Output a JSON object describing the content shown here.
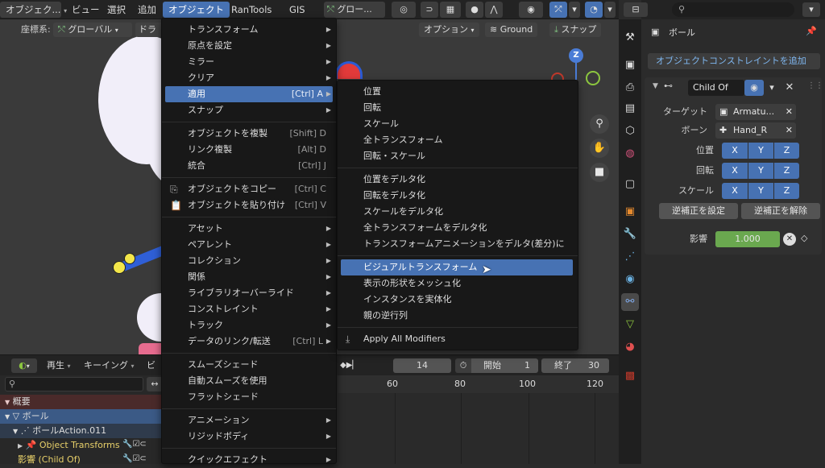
{
  "header": {
    "mode_partial": "オブジェク...",
    "menus": [
      "ビュー",
      "選択",
      "追加",
      "オブジェクト",
      "RanTools",
      "GIS"
    ],
    "active_menu": "オブジェクト",
    "orientation_partial": "グロー..."
  },
  "viewport_header": {
    "coord_label": "座標系:",
    "coord_value": "グローバル",
    "drag_partial": "ドラ",
    "options": "オプション",
    "ground": "Ground",
    "snap": "スナップ"
  },
  "gizmo": {
    "z": "Z"
  },
  "object_menu": {
    "items": [
      {
        "label": "トランスフォーム",
        "shortcut": "",
        "submenu": true
      },
      {
        "label": "原点を設定",
        "shortcut": "",
        "submenu": true
      },
      {
        "label": "ミラー",
        "shortcut": "",
        "submenu": true
      },
      {
        "label": "クリア",
        "shortcut": "",
        "submenu": true
      },
      {
        "label": "適用",
        "shortcut": "[Ctrl] A",
        "submenu": true,
        "highlight": true
      },
      {
        "label": "スナップ",
        "shortcut": "",
        "submenu": true
      },
      {
        "label": "オブジェクトを複製",
        "shortcut": "[Shift] D",
        "submenu": false
      },
      {
        "label": "リンク複製",
        "shortcut": "[Alt] D",
        "submenu": false
      },
      {
        "label": "統合",
        "shortcut": "[Ctrl] J",
        "submenu": false
      },
      {
        "label": "オブジェクトをコピー",
        "shortcut": "[Ctrl] C",
        "submenu": false
      },
      {
        "label": "オブジェクトを貼り付け",
        "shortcut": "[Ctrl] V",
        "submenu": false
      },
      {
        "label": "アセット",
        "shortcut": "",
        "submenu": true
      },
      {
        "label": "ペアレント",
        "shortcut": "",
        "submenu": true
      },
      {
        "label": "コレクション",
        "shortcut": "",
        "submenu": true
      },
      {
        "label": "関係",
        "shortcut": "",
        "submenu": true
      },
      {
        "label": "ライブラリオーバーライド",
        "shortcut": "",
        "submenu": true
      },
      {
        "label": "コンストレイント",
        "shortcut": "",
        "submenu": true
      },
      {
        "label": "トラック",
        "shortcut": "",
        "submenu": true
      },
      {
        "label": "データのリンク/転送",
        "shortcut": "[Ctrl] L",
        "submenu": true
      },
      {
        "label": "スムーズシェード",
        "shortcut": "",
        "submenu": false
      },
      {
        "label": "自動スムーズを使用",
        "shortcut": "",
        "submenu": false
      },
      {
        "label": "フラットシェード",
        "shortcut": "",
        "submenu": false
      },
      {
        "label": "アニメーション",
        "shortcut": "",
        "submenu": true
      },
      {
        "label": "リジッドボディ",
        "shortcut": "",
        "submenu": true
      },
      {
        "label": "クイックエフェクト",
        "shortcut": "",
        "submenu": true
      }
    ]
  },
  "apply_menu": {
    "items": [
      "位置",
      "回転",
      "スケール",
      "全トランスフォーム",
      "回転・スケール",
      "位置をデルタ化",
      "回転をデルタ化",
      "スケールをデルタ化",
      "全トランスフォームをデルタ化",
      "トランスフォームアニメーションをデルタ(差分)に",
      "ビジュアルトランスフォーム",
      "表示の形状をメッシュ化",
      "インスタンスを実体化",
      "親の逆行列",
      "Apply All Modifiers"
    ],
    "highlight": "ビジュアルトランスフォーム"
  },
  "timeline": {
    "playback": "再生",
    "keying": "キーイング",
    "view_partial": "ビ",
    "current_frame": "14",
    "start_label": "開始",
    "start_value": "1",
    "end_label": "終了",
    "end_value": "30",
    "ticks": [
      "60",
      "80",
      "100",
      "120"
    ]
  },
  "outliner": {
    "rows": [
      {
        "label": "概要"
      },
      {
        "label": "ボール"
      },
      {
        "label": "ボールAction.011"
      },
      {
        "label": "Object Transforms"
      },
      {
        "label": "影響 (Child Of)"
      }
    ]
  },
  "properties": {
    "search_placeholder": "",
    "object_name": "ボール",
    "add_constraint": "オブジェクトコンストレイントを追加",
    "constraint_name": "Child Of",
    "target_label": "ターゲット",
    "target_value": "Armatu...",
    "bone_label": "ボーン",
    "bone_value": "Hand_R",
    "location_label": "位置",
    "rotation_label": "回転",
    "scale_label": "スケール",
    "axes": [
      "X",
      "Y",
      "Z"
    ],
    "set_inverse": "逆補正を設定",
    "clear_inverse": "逆補正を解除",
    "influence_label": "影響",
    "influence_value": "1.000",
    "influence_fraction": 1.0
  },
  "colors": {
    "accent": "#4772b3",
    "header_bg": "#232323",
    "menu_bg": "#181818",
    "influence": "#6aa84f"
  }
}
